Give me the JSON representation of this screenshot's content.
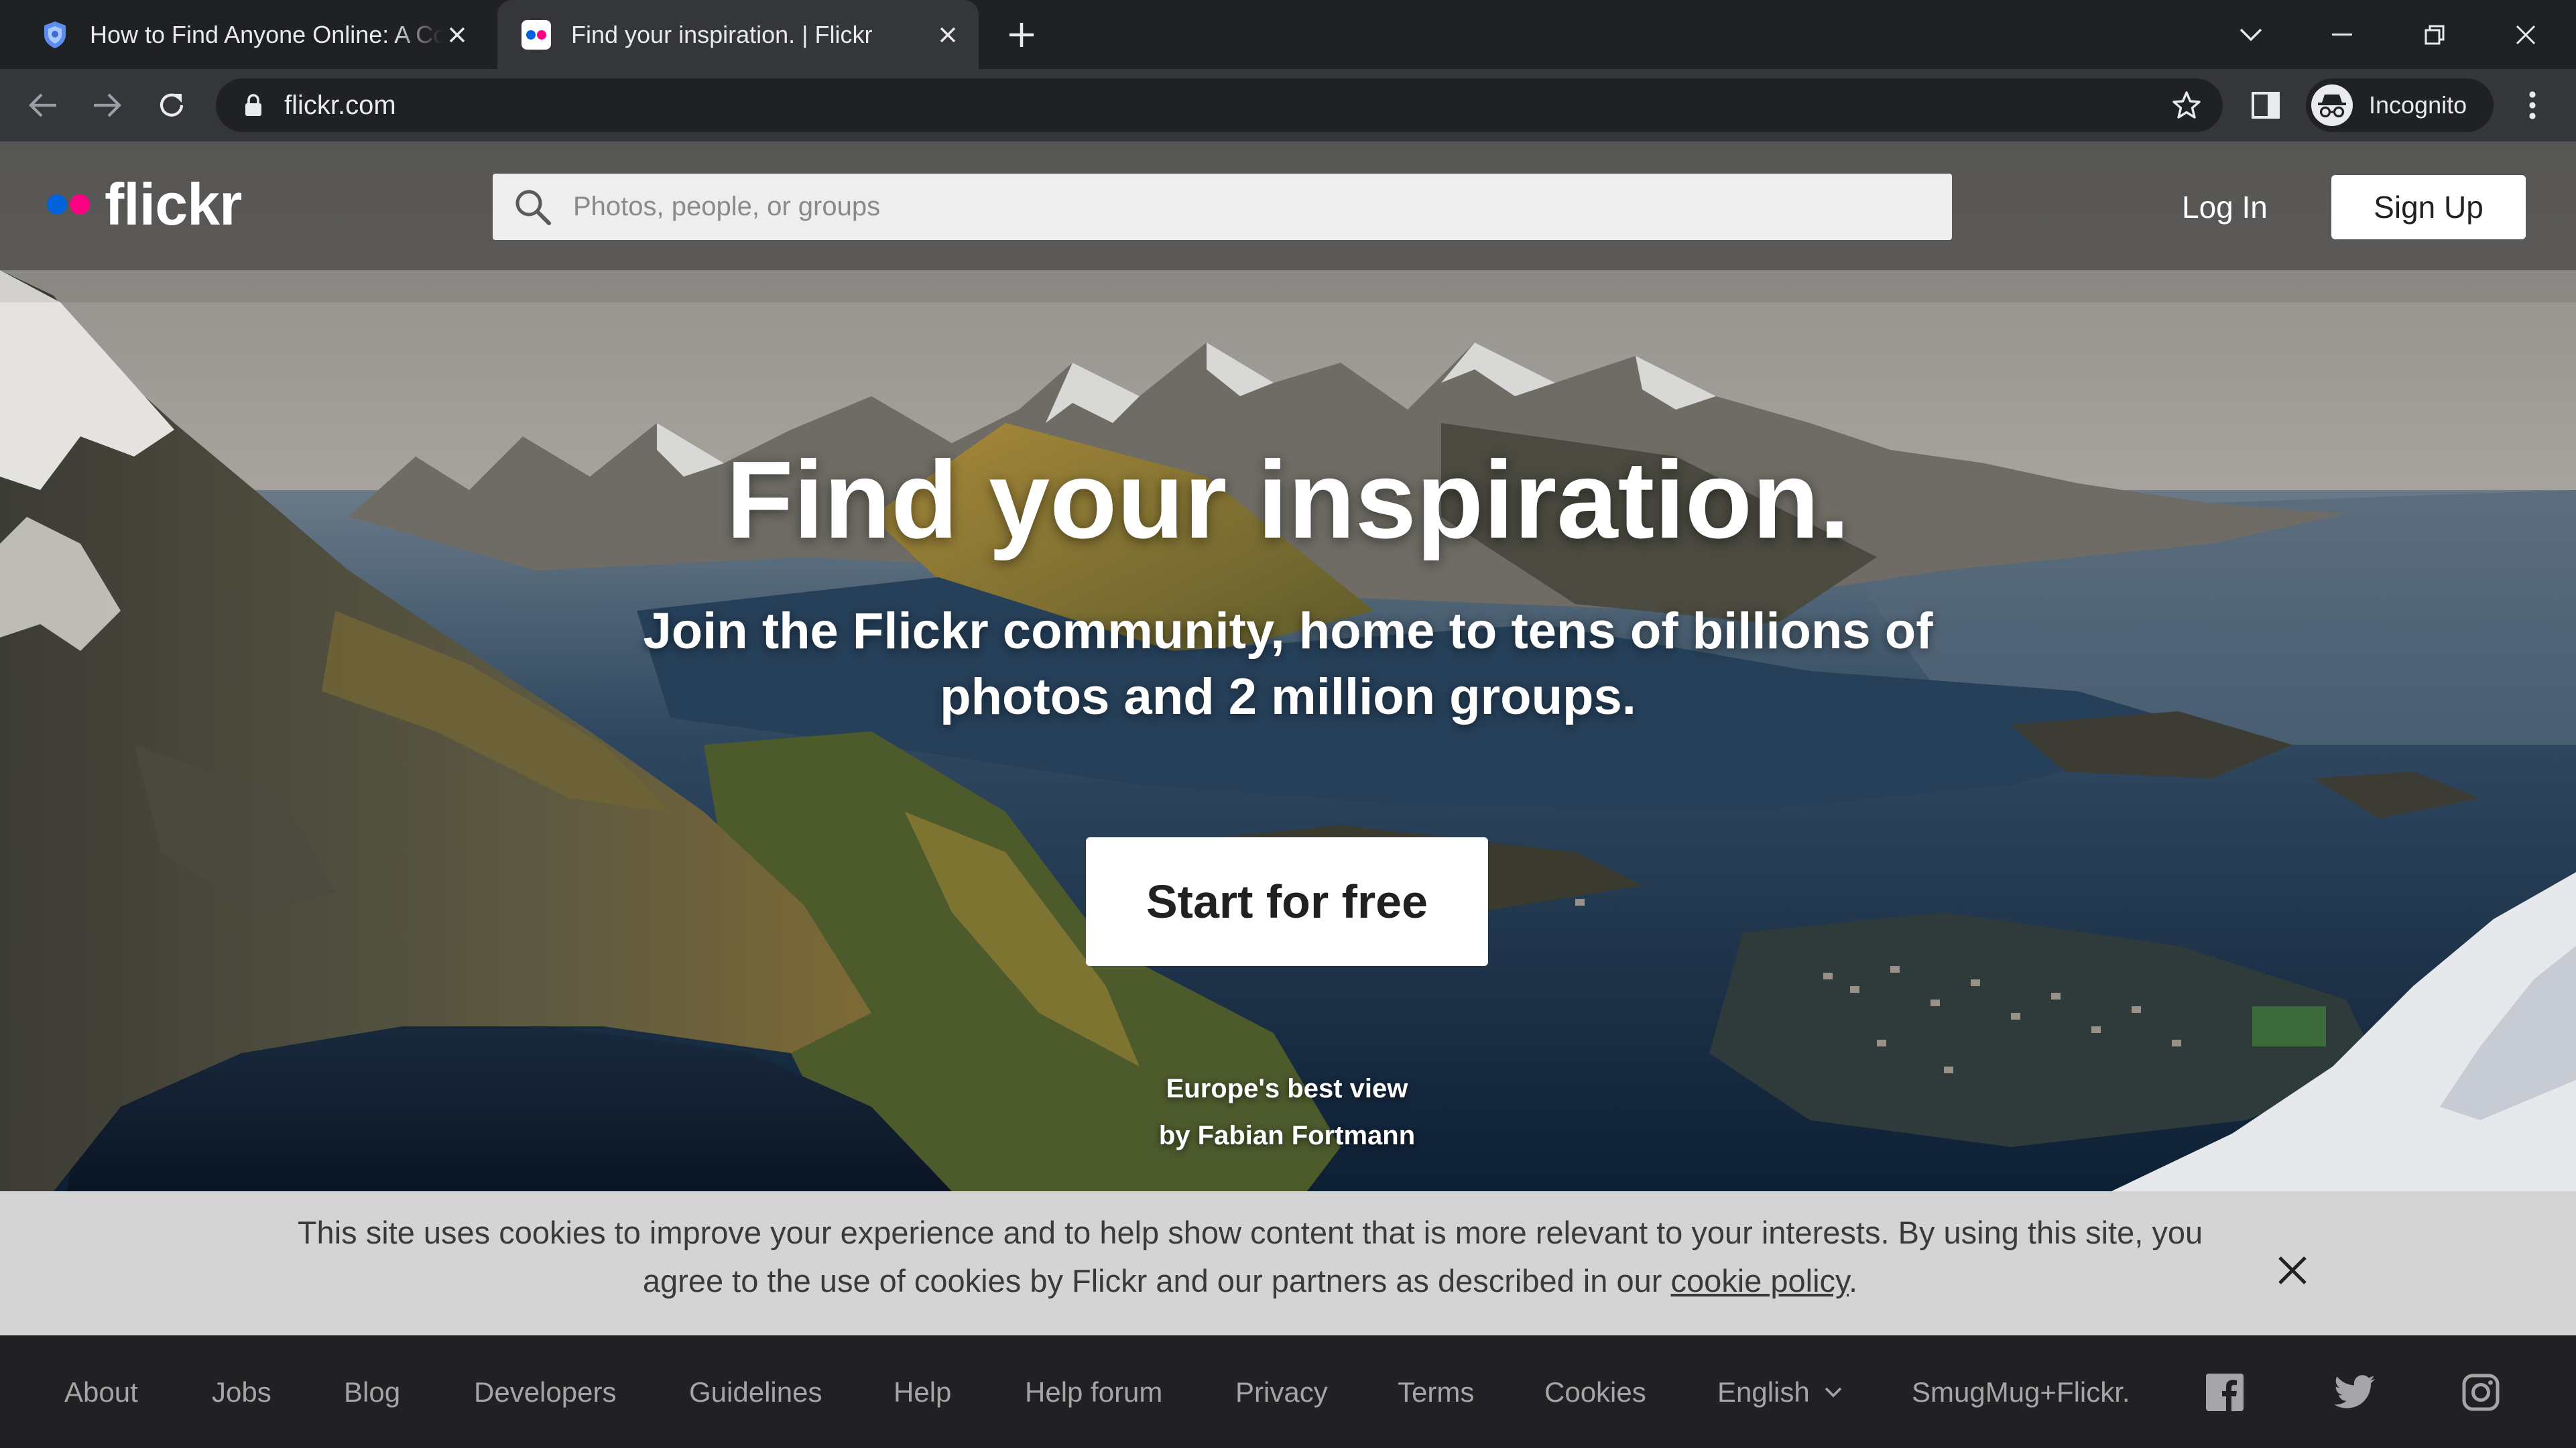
{
  "browser": {
    "tabs": [
      {
        "title": "How to Find Anyone Online: A Co",
        "active": false,
        "favicon": "shield-icon"
      },
      {
        "title": "Find your inspiration. | Flickr",
        "active": true,
        "favicon": "flickr-dots-icon"
      }
    ],
    "url": "flickr.com",
    "profile_label": "Incognito"
  },
  "site": {
    "brand": "flickr",
    "brand_colors": {
      "blue": "#0063dc",
      "pink": "#ff0084"
    },
    "search_placeholder": "Photos, people, or groups",
    "login_label": "Log In",
    "signup_label": "Sign Up"
  },
  "hero": {
    "headline": "Find your inspiration.",
    "subline_1": "Join the Flickr community, home to tens of billions of",
    "subline_2": "photos and 2 million groups.",
    "cta_label": "Start for free",
    "photo_title": "Europe's best view",
    "photo_credit": "by Fabian Fortmann"
  },
  "cookie": {
    "message_part1": "This site uses cookies to improve your experience and to help show content that is more relevant to your interests. By using this site, you agree to the use of cookies by Flickr and our partners as described in our ",
    "link_text": "cookie policy",
    "message_part2": "."
  },
  "footer": {
    "links": [
      "About",
      "Jobs",
      "Blog",
      "Developers",
      "Guidelines",
      "Help",
      "Help forum",
      "Privacy",
      "Terms",
      "Cookies"
    ],
    "language": "English",
    "smugmug": "SmugMug+Flickr.",
    "social": [
      "facebook-icon",
      "twitter-icon",
      "instagram-icon"
    ]
  }
}
